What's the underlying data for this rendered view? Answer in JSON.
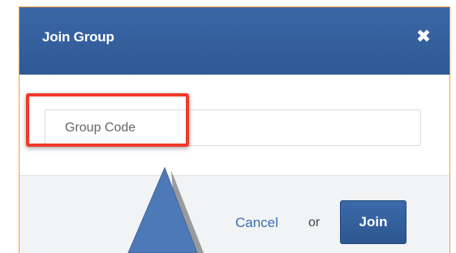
{
  "dialog": {
    "title": "Join Group",
    "close_icon": "close-icon"
  },
  "form": {
    "group_code_placeholder": "Group Code",
    "group_code_value": ""
  },
  "footer": {
    "cancel_label": "Cancel",
    "or_label": "or",
    "join_label": "Join"
  },
  "annotation": {
    "highlight_color": "#f03a2a",
    "pointer_color": "#4e79b8"
  },
  "colors": {
    "header": "#3060a0",
    "accent_border": "#f39c3c",
    "link": "#3a6fb3"
  }
}
